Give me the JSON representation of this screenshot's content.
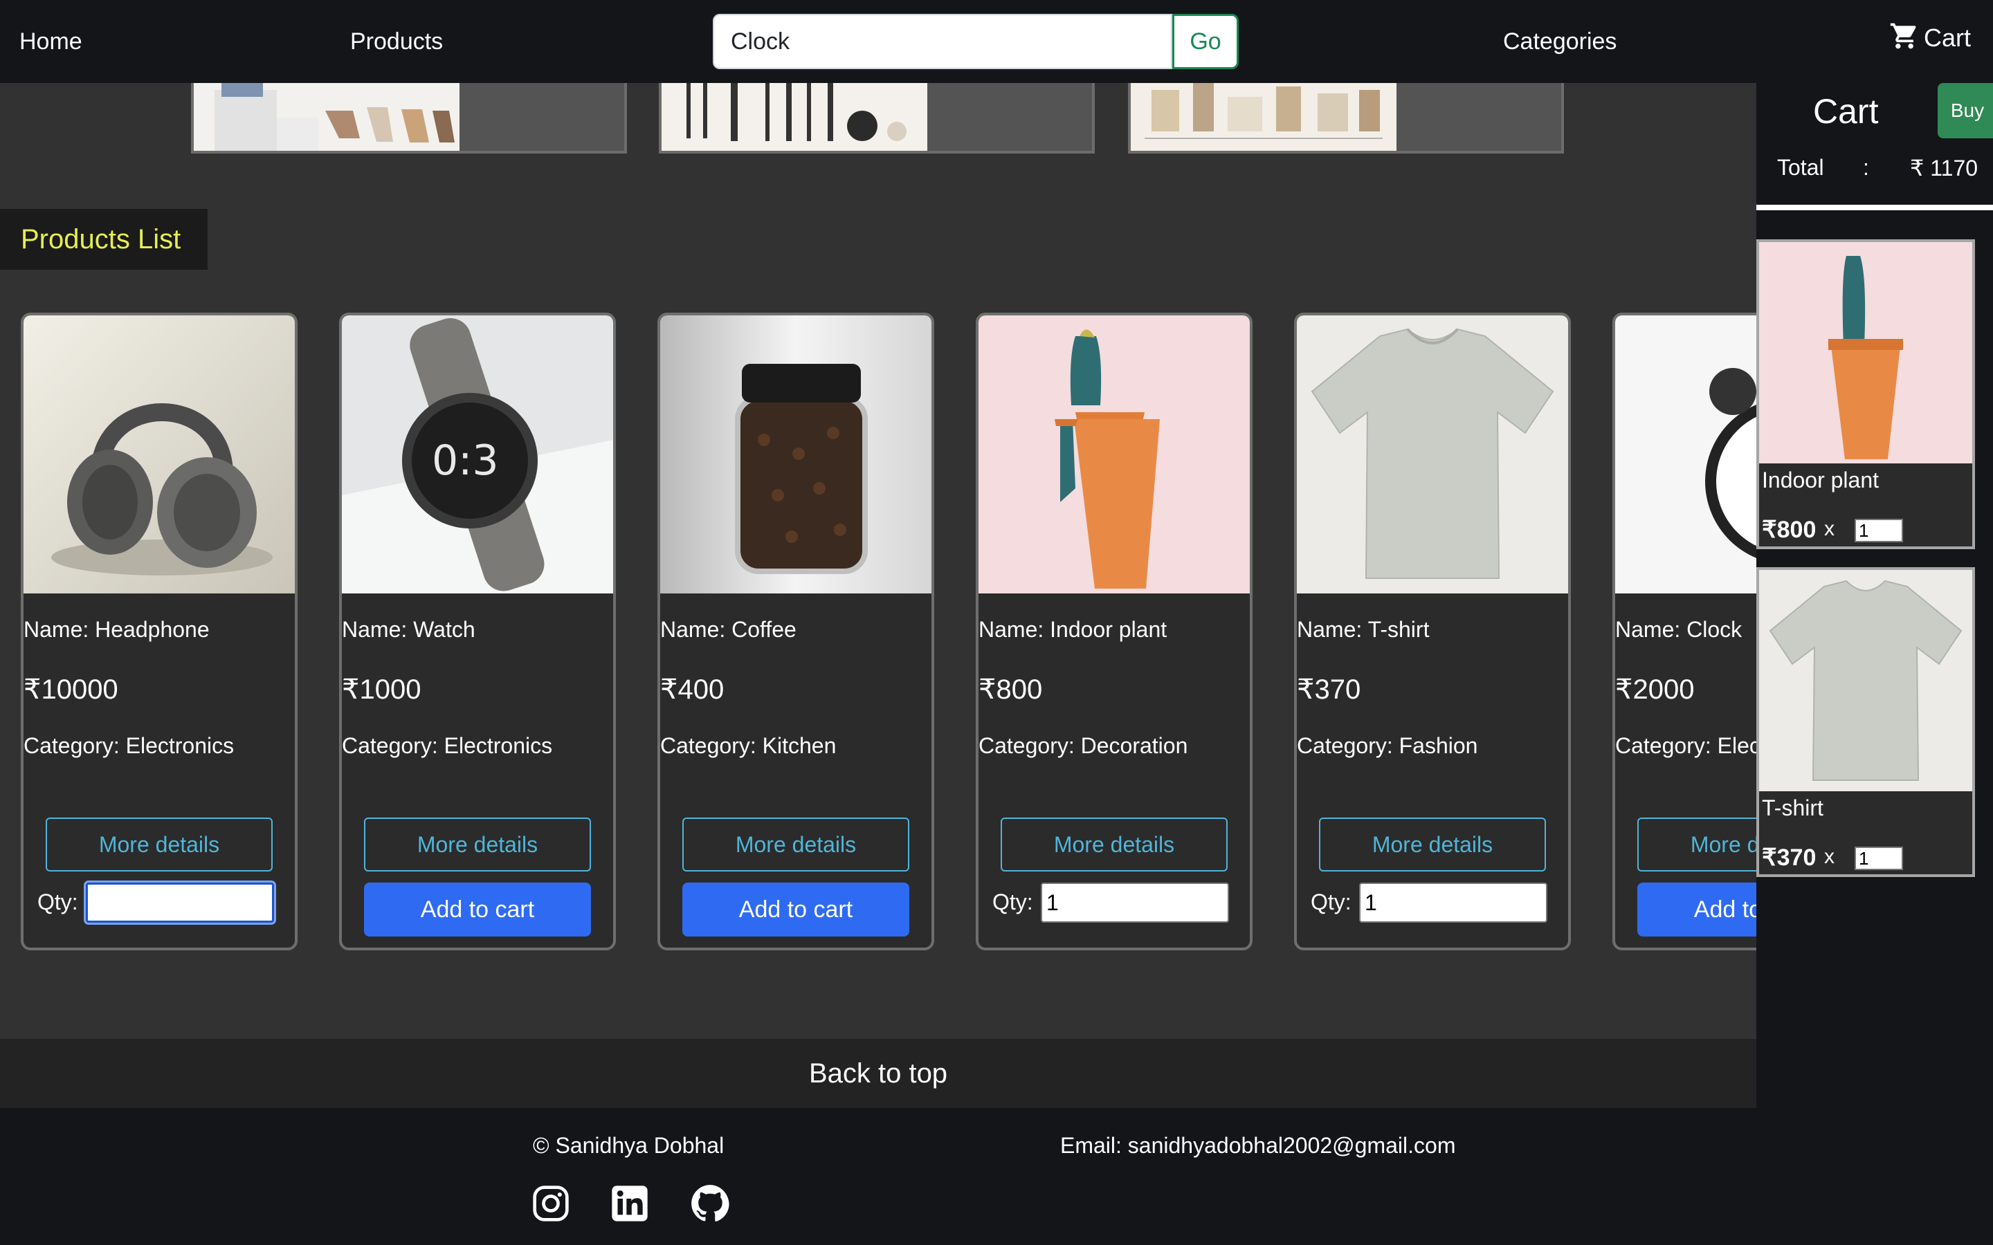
{
  "nav": {
    "home": "Home",
    "products": "Products",
    "search_value": "Clock",
    "go": "Go",
    "categories": "Categories",
    "cart": "Cart"
  },
  "section_title": "Products List",
  "currency": "₹",
  "products": [
    {
      "name_line": "Name: Headphone",
      "price": "₹10000",
      "category_line": "Category: Electronics",
      "details": "More details",
      "qty_label": "Qty:",
      "qty": ""
    },
    {
      "name_line": "Name: Watch",
      "price": "₹1000",
      "category_line": "Category: Electronics",
      "details": "More details",
      "add": "Add to cart"
    },
    {
      "name_line": "Name: Coffee",
      "price": "₹400",
      "category_line": "Category: Kitchen",
      "details": "More details",
      "add": "Add to cart"
    },
    {
      "name_line": "Name: Indoor plant",
      "price": "₹800",
      "category_line": "Category: Decoration",
      "details": "More details",
      "qty_label": "Qty:",
      "qty": "1"
    },
    {
      "name_line": "Name: T-shirt",
      "price": "₹370",
      "category_line": "Category: Fashion",
      "details": "More details",
      "qty_label": "Qty:",
      "qty": "1"
    },
    {
      "name_line": "Name: Clock",
      "price": "₹2000",
      "category_line": "Category: Electronics",
      "details": "More details",
      "add": "Add to cart"
    }
  ],
  "cart": {
    "title": "Cart",
    "buy": "Buy",
    "total_label": "Total",
    "total_colon": ":",
    "total_value": "₹ 1170",
    "items": [
      {
        "name": "Indoor plant",
        "price": "₹800",
        "x": "x",
        "qty": "1"
      },
      {
        "name": "T-shirt",
        "price": "₹370",
        "x": "x",
        "qty": "1"
      }
    ]
  },
  "back_to_top": "Back to top",
  "footer": {
    "copyright": "© Sanidhya Dobhal",
    "email": "Email: sanidhyadobhal2002@gmail.com",
    "social": [
      "instagram-icon",
      "linkedin-icon",
      "github-icon"
    ]
  },
  "colors": {
    "page_bg": "#323232",
    "nav_bg": "#131519",
    "accent_title": "#e6ee52",
    "details_outline": "#4fb5d9",
    "add_button": "#2f6bf2",
    "buy_button": "#2f8a55",
    "go_outline": "#198754"
  }
}
